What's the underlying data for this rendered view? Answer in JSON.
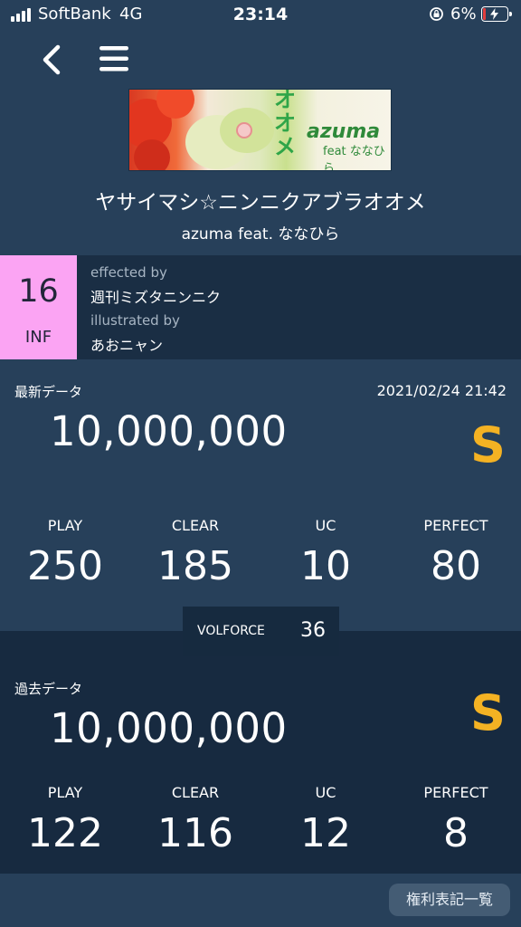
{
  "status_bar": {
    "carrier": "SoftBank",
    "network": "4G",
    "time": "23:14",
    "battery_percent": "6%"
  },
  "nav": {
    "back_icon": "chevron-left-icon",
    "menu_icon": "hamburger-menu-icon"
  },
  "song": {
    "jacket_text_main": "azuma",
    "jacket_text_sub": "feat ななひら",
    "jacket_text_vertical": "オオメ",
    "title": "ヤサイマシ☆ニンニクアブラオオメ",
    "artist": "azuma feat. ななひら"
  },
  "chart": {
    "level": "16",
    "difficulty": "INF",
    "difficulty_color": "#fba4f3",
    "effected_by_label": "effected by",
    "effected_by": "週刊ミズタニンニク",
    "illustrated_by_label": "illustrated by",
    "illustrated_by": "あおニャン"
  },
  "latest": {
    "label": "最新データ",
    "date": "2021/02/24 21:42",
    "score": "10,000,000",
    "grade": "S",
    "stats": [
      {
        "label": "PLAY",
        "value": "250"
      },
      {
        "label": "CLEAR",
        "value": "185"
      },
      {
        "label": "UC",
        "value": "10"
      },
      {
        "label": "PERFECT",
        "value": "80"
      }
    ]
  },
  "volforce": {
    "label": "VOLFORCE",
    "value": "36"
  },
  "past": {
    "label": "過去データ",
    "score": "10,000,000",
    "grade": "S",
    "stats": [
      {
        "label": "PLAY",
        "value": "122"
      },
      {
        "label": "CLEAR",
        "value": "116"
      },
      {
        "label": "UC",
        "value": "12"
      },
      {
        "label": "PERFECT",
        "value": "8"
      }
    ]
  },
  "footer": {
    "rights_button": "権利表記一覧"
  },
  "colors": {
    "background": "#27405a",
    "grade": "#f4b223",
    "dark_panel": "#172a40"
  }
}
